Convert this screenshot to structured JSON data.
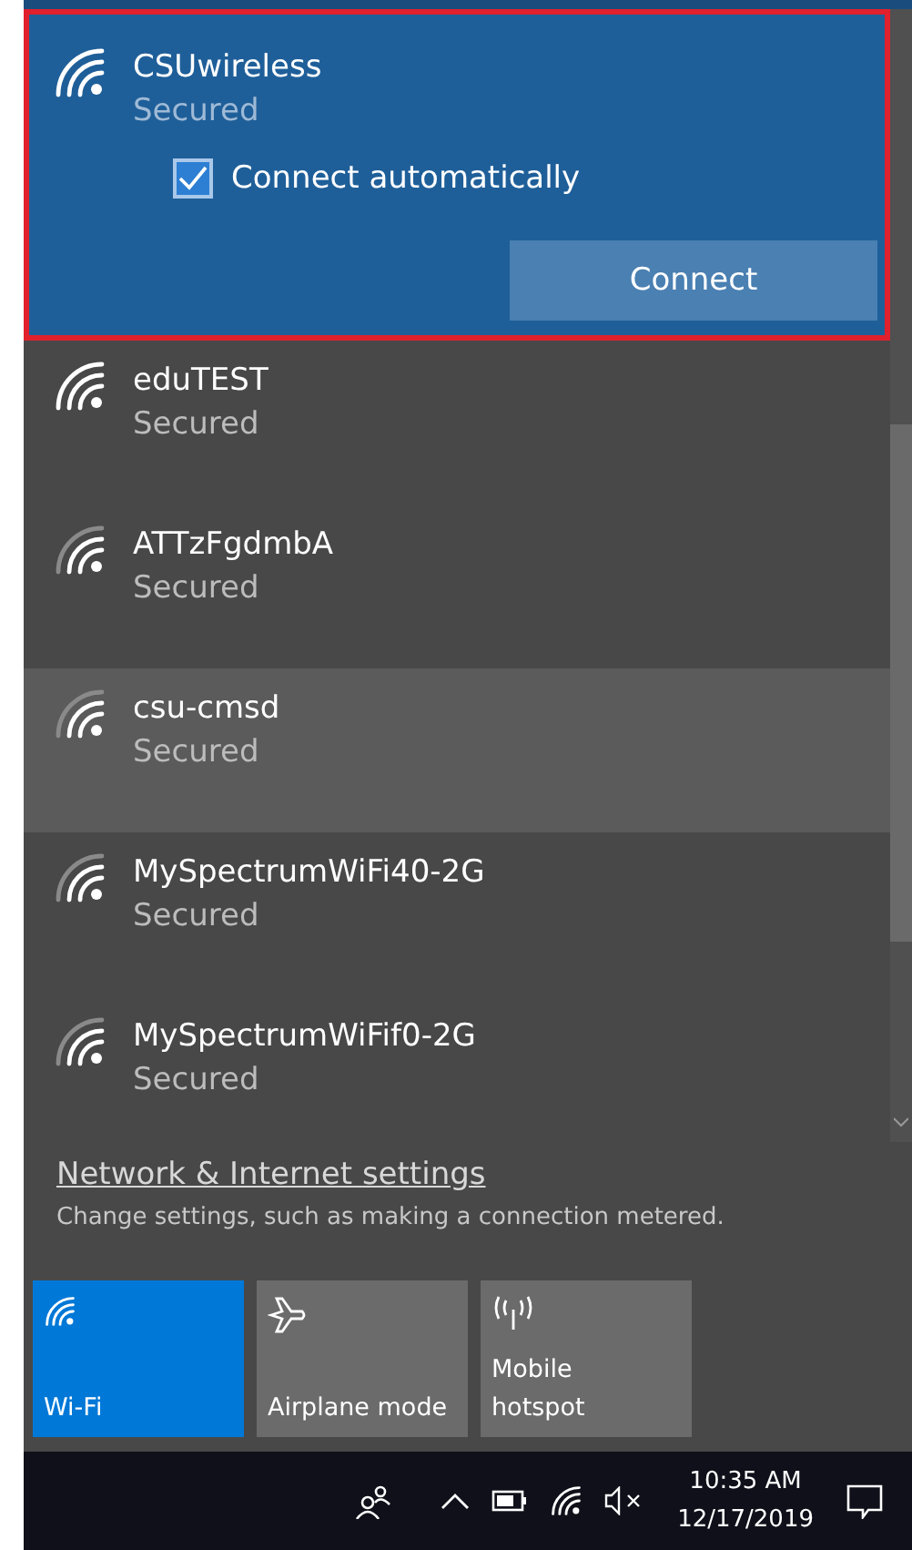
{
  "networks": [
    {
      "name": "CSUwireless",
      "status": "Secured",
      "full_signal": true,
      "expanded": true,
      "hovered": false,
      "auto_connect": {
        "label": "Connect automatically",
        "checked": true
      },
      "button": "Connect"
    },
    {
      "name": "eduTEST",
      "status": "Secured",
      "full_signal": true,
      "expanded": false,
      "hovered": false
    },
    {
      "name": "ATTzFgdmbA",
      "status": "Secured",
      "full_signal": false,
      "expanded": false,
      "hovered": false
    },
    {
      "name": "csu-cmsd",
      "status": "Secured",
      "full_signal": false,
      "expanded": false,
      "hovered": true
    },
    {
      "name": "MySpectrumWiFi40-2G",
      "status": "Secured",
      "full_signal": false,
      "expanded": false,
      "hovered": false
    },
    {
      "name": "MySpectrumWiFif0-2G",
      "status": "Secured",
      "full_signal": false,
      "expanded": false,
      "hovered": false
    }
  ],
  "settings": {
    "link": "Network & Internet settings",
    "description": "Change settings, such as making a connection metered."
  },
  "tiles": [
    {
      "kind": "wifi",
      "label": "Wi-Fi",
      "on": true
    },
    {
      "kind": "airplane",
      "label": "Airplane mode",
      "on": false
    },
    {
      "kind": "hotspot",
      "label": "Mobile\nhotspot",
      "on": false
    }
  ],
  "taskbar": {
    "time": "10:35 AM",
    "date": "12/17/2019"
  }
}
